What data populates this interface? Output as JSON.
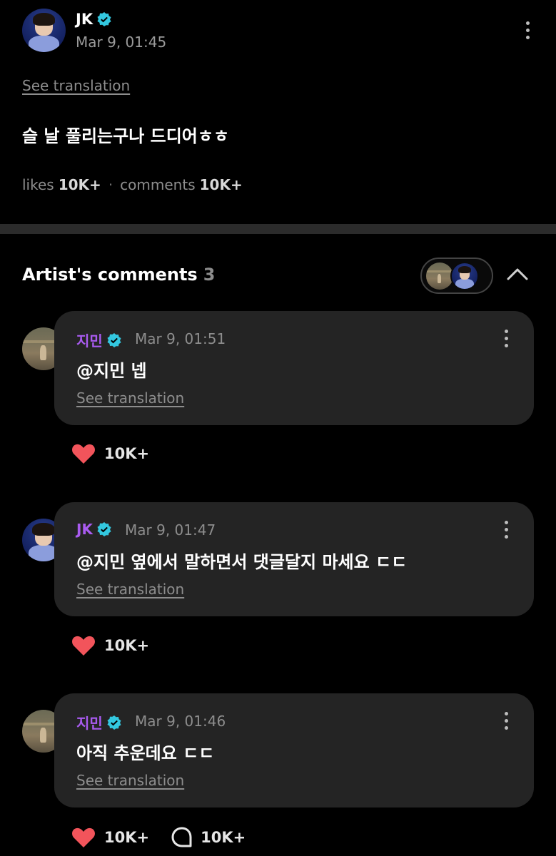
{
  "post": {
    "author": "JK",
    "timestamp": "Mar 9, 01:45",
    "see_translation": "See translation",
    "body": "슬 날 풀리는구나 드디어ㅎㅎ",
    "likes_label": "likes",
    "likes_count": "10K+",
    "comments_label": "comments",
    "comments_count": "10K+"
  },
  "artist_comments": {
    "title": "Artist's comments",
    "count": "3"
  },
  "comments": [
    {
      "author": "지민",
      "timestamp": "Mar 9, 01:51",
      "text": "@지민 넵",
      "see_translation": "See translation",
      "likes": "10K+"
    },
    {
      "author": "JK",
      "timestamp": "Mar 9, 01:47",
      "text": "@지민 옆에서 말하면서 댓글달지 마세요 ㄷㄷ",
      "see_translation": "See translation",
      "likes": "10K+"
    },
    {
      "author": "지민",
      "timestamp": "Mar 9, 01:46",
      "text": "아직 추운데요 ㄷㄷ",
      "see_translation": "See translation",
      "likes": "10K+",
      "replies": "10K+"
    }
  ],
  "colors": {
    "background": "#000000",
    "card": "#242424",
    "artist_name": "#a95bf0",
    "verified_badge": "#33c8e0",
    "heart": "#f2545b",
    "muted_text": "#8d8d8d"
  },
  "icons": [
    "verified-badge-icon",
    "more-options-icon",
    "chevron-up-icon",
    "heart-icon",
    "comment-bubble-icon"
  ]
}
